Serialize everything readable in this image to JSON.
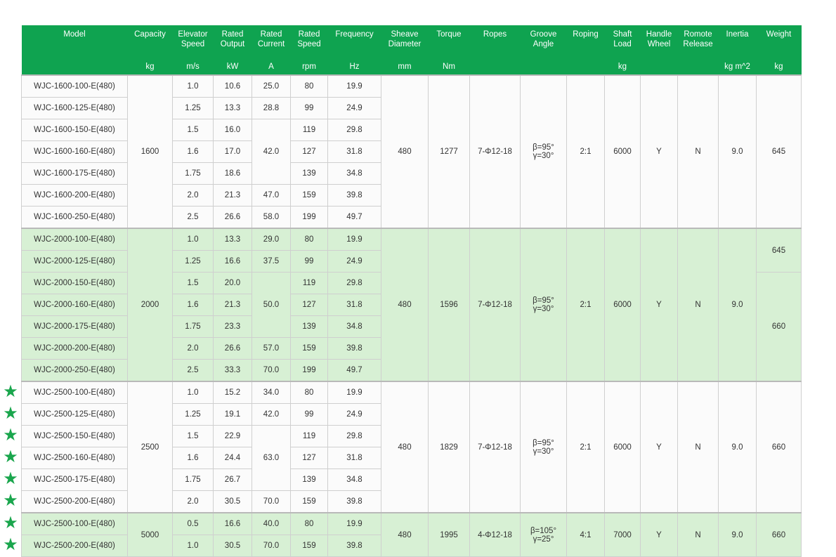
{
  "header": {
    "columns": [
      {
        "name": "Model",
        "unit": ""
      },
      {
        "name": "Capacity",
        "unit": "kg"
      },
      {
        "name": "Elevator Speed",
        "unit": "m/s"
      },
      {
        "name": "Rated Output",
        "unit": "kW"
      },
      {
        "name": "Rated Current",
        "unit": "A"
      },
      {
        "name": "Rated Speed",
        "unit": "rpm"
      },
      {
        "name": "Frequency",
        "unit": "Hz"
      },
      {
        "name": "Sheave Diameter",
        "unit": "mm"
      },
      {
        "name": "Torque",
        "unit": "Nm"
      },
      {
        "name": "Ropes",
        "unit": ""
      },
      {
        "name": "Groove Angle",
        "unit": ""
      },
      {
        "name": "Roping",
        "unit": ""
      },
      {
        "name": "Shaft Load",
        "unit": "kg"
      },
      {
        "name": "Handle Wheel",
        "unit": ""
      },
      {
        "name": "Romote Release",
        "unit": ""
      },
      {
        "name": "Inertia",
        "unit": "kg m^2"
      },
      {
        "name": "Weight",
        "unit": "kg"
      }
    ]
  },
  "colors": {
    "header_bg": "#0fa350",
    "group_green": "#d7f0d4",
    "star": "#1aa64d"
  },
  "star_icon": "star-icon",
  "groups": [
    {
      "shading": "white",
      "capacity": "1600",
      "sheave": "480",
      "torque": "1277",
      "ropes": "7-Φ12-18",
      "groove_beta": "β=95°",
      "groove_gamma": "γ=30°",
      "roping": "2:1",
      "shaft_load": "6000",
      "handle_wheel": "Y",
      "remote_release": "N",
      "inertia": "9.0",
      "weight": "645",
      "rows": [
        {
          "model": "WJC-1600-100-E(480)",
          "speed": "1.0",
          "output": "10.6",
          "current": "25.0",
          "rpm": "80",
          "hz": "19.9"
        },
        {
          "model": "WJC-1600-125-E(480)",
          "speed": "1.25",
          "output": "13.3",
          "current": "28.8",
          "rpm": "99",
          "hz": "24.9"
        },
        {
          "model": "WJC-1600-150-E(480)",
          "speed": "1.5",
          "output": "16.0",
          "current": "42.0",
          "rpm": "119",
          "hz": "29.8"
        },
        {
          "model": "WJC-1600-160-E(480)",
          "speed": "1.6",
          "output": "17.0",
          "rpm": "127",
          "hz": "31.8"
        },
        {
          "model": "WJC-1600-175-E(480)",
          "speed": "1.75",
          "output": "18.6",
          "rpm": "139",
          "hz": "34.8"
        },
        {
          "model": "WJC-1600-200-E(480)",
          "speed": "2.0",
          "output": "21.3",
          "current": "47.0",
          "rpm": "159",
          "hz": "39.8"
        },
        {
          "model": "WJC-1600-250-E(480)",
          "speed": "2.5",
          "output": "26.6",
          "current": "58.0",
          "rpm": "199",
          "hz": "49.7"
        }
      ]
    },
    {
      "shading": "green",
      "capacity": "2000",
      "sheave": "480",
      "torque": "1596",
      "ropes": "7-Φ12-18",
      "groove_beta": "β=95°",
      "groove_gamma": "γ=30°",
      "roping": "2:1",
      "shaft_load": "6000",
      "handle_wheel": "Y",
      "remote_release": "N",
      "inertia": "9.0",
      "weight_a": "645",
      "weight_b": "660",
      "rows": [
        {
          "model": "WJC-2000-100-E(480)",
          "speed": "1.0",
          "output": "13.3",
          "current": "29.0",
          "rpm": "80",
          "hz": "19.9"
        },
        {
          "model": "WJC-2000-125-E(480)",
          "speed": "1.25",
          "output": "16.6",
          "current": "37.5",
          "rpm": "99",
          "hz": "24.9"
        },
        {
          "model": "WJC-2000-150-E(480)",
          "speed": "1.5",
          "output": "20.0",
          "current": "50.0",
          "rpm": "119",
          "hz": "29.8"
        },
        {
          "model": "WJC-2000-160-E(480)",
          "speed": "1.6",
          "output": "21.3",
          "rpm": "127",
          "hz": "31.8"
        },
        {
          "model": "WJC-2000-175-E(480)",
          "speed": "1.75",
          "output": "23.3",
          "rpm": "139",
          "hz": "34.8"
        },
        {
          "model": "WJC-2000-200-E(480)",
          "speed": "2.0",
          "output": "26.6",
          "current": "57.0",
          "rpm": "159",
          "hz": "39.8"
        },
        {
          "model": "WJC-2000-250-E(480)",
          "speed": "2.5",
          "output": "33.3",
          "current": "70.0",
          "rpm": "199",
          "hz": "49.7"
        }
      ]
    },
    {
      "shading": "white",
      "capacity": "2500",
      "sheave": "480",
      "torque": "1829",
      "ropes": "7-Φ12-18",
      "groove_beta": "β=95°",
      "groove_gamma": "γ=30°",
      "roping": "2:1",
      "shaft_load": "6000",
      "handle_wheel": "Y",
      "remote_release": "N",
      "inertia": "9.0",
      "weight": "660",
      "rows": [
        {
          "model": "WJC-2500-100-E(480)",
          "speed": "1.0",
          "output": "15.2",
          "current": "34.0",
          "rpm": "80",
          "hz": "19.9"
        },
        {
          "model": "WJC-2500-125-E(480)",
          "speed": "1.25",
          "output": "19.1",
          "current": "42.0",
          "rpm": "99",
          "hz": "24.9"
        },
        {
          "model": "WJC-2500-150-E(480)",
          "speed": "1.5",
          "output": "22.9",
          "current": "63.0",
          "rpm": "119",
          "hz": "29.8"
        },
        {
          "model": "WJC-2500-160-E(480)",
          "speed": "1.6",
          "output": "24.4",
          "rpm": "127",
          "hz": "31.8"
        },
        {
          "model": "WJC-2500-175-E(480)",
          "speed": "1.75",
          "output": "26.7",
          "rpm": "139",
          "hz": "34.8"
        },
        {
          "model": "WJC-2500-200-E(480)",
          "speed": "2.0",
          "output": "30.5",
          "current": "70.0",
          "rpm": "159",
          "hz": "39.8"
        }
      ]
    },
    {
      "shading": "green",
      "capacity": "5000",
      "sheave": "480",
      "torque": "1995",
      "ropes": "4-Φ12-18",
      "groove_beta": "β=105°",
      "groove_gamma": "γ=25°",
      "roping": "4:1",
      "shaft_load": "7000",
      "handle_wheel": "Y",
      "remote_release": "N",
      "inertia": "9.0",
      "weight": "660",
      "rows": [
        {
          "model": "WJC-2500-100-E(480)",
          "speed": "0.5",
          "output": "16.6",
          "current": "40.0",
          "rpm": "80",
          "hz": "19.9"
        },
        {
          "model": "WJC-2500-200-E(480)",
          "speed": "1.0",
          "output": "30.5",
          "current": "70.0",
          "rpm": "159",
          "hz": "39.8"
        }
      ]
    }
  ]
}
